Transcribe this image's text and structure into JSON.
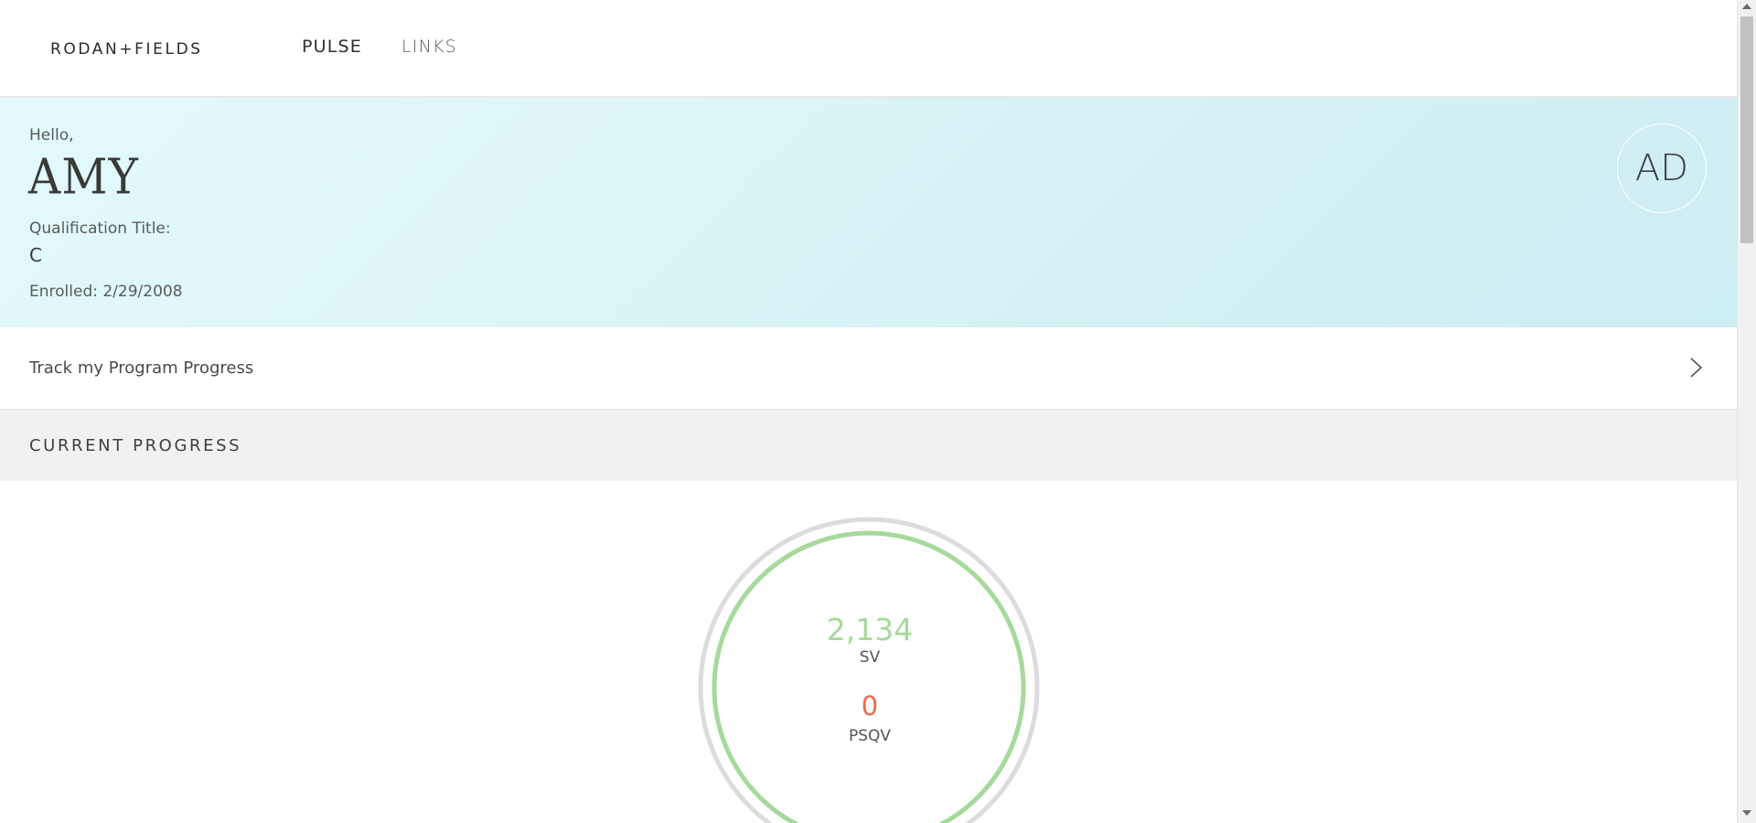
{
  "header": {
    "logo": "RODAN+FIELDS",
    "nav": [
      {
        "label": "PULSE",
        "active": true
      },
      {
        "label": "LINKS",
        "active": false
      }
    ]
  },
  "profile": {
    "greeting": "Hello,",
    "name": "AMY",
    "qualification_label": "Qualification Title:",
    "qualification_value": "C",
    "enrolled": "Enrolled: 2/29/2008",
    "avatar_initials": "AD"
  },
  "track": {
    "label": "Track my Program Progress",
    "icon": "chevron-right-icon"
  },
  "current_progress": {
    "title": "CURRENT PROGRESS",
    "sv_value": "2,134",
    "sv_label": "SV",
    "psqv_value": "0",
    "psqv_label": "PSQV",
    "sv_progress_fraction": 1.0
  },
  "colors": {
    "hero_gradient_start": "#e3fafc",
    "hero_gradient_end": "#cdeef5",
    "sv_green": "#a6d99c",
    "psqv_orange": "#e96a45",
    "ring_gray": "#dcdcdc",
    "section_bg": "#f1f1f1"
  }
}
